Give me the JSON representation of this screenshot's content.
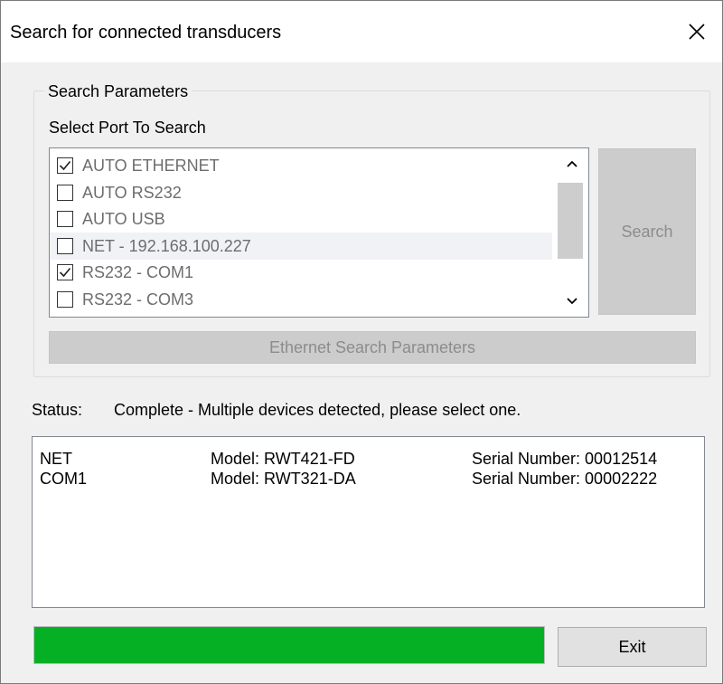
{
  "window": {
    "title": "Search for connected transducers",
    "close_icon": "close-icon"
  },
  "search_parameters": {
    "group_title": "Search Parameters",
    "select_label": "Select Port To Search",
    "ports": [
      {
        "label": "AUTO ETHERNET",
        "checked": true
      },
      {
        "label": "AUTO RS232",
        "checked": false
      },
      {
        "label": "AUTO USB",
        "checked": false
      },
      {
        "label": "NET - 192.168.100.227",
        "checked": false
      },
      {
        "label": "RS232 - COM1",
        "checked": true
      },
      {
        "label": "RS232 - COM3",
        "checked": false
      }
    ],
    "search_button": "Search",
    "ethernet_button": "Ethernet Search Parameters"
  },
  "status": {
    "label": "Status:",
    "text": "Complete - Multiple devices detected, please select one."
  },
  "devices": [
    {
      "port": "NET",
      "model": "Model: RWT421-FD",
      "serial": "Serial Number: 00012514"
    },
    {
      "port": "COM1",
      "model": "Model: RWT321-DA",
      "serial": "Serial Number: 00002222"
    }
  ],
  "progress": {
    "fraction": 1.0,
    "color": "#06b025"
  },
  "exit_button": "Exit"
}
